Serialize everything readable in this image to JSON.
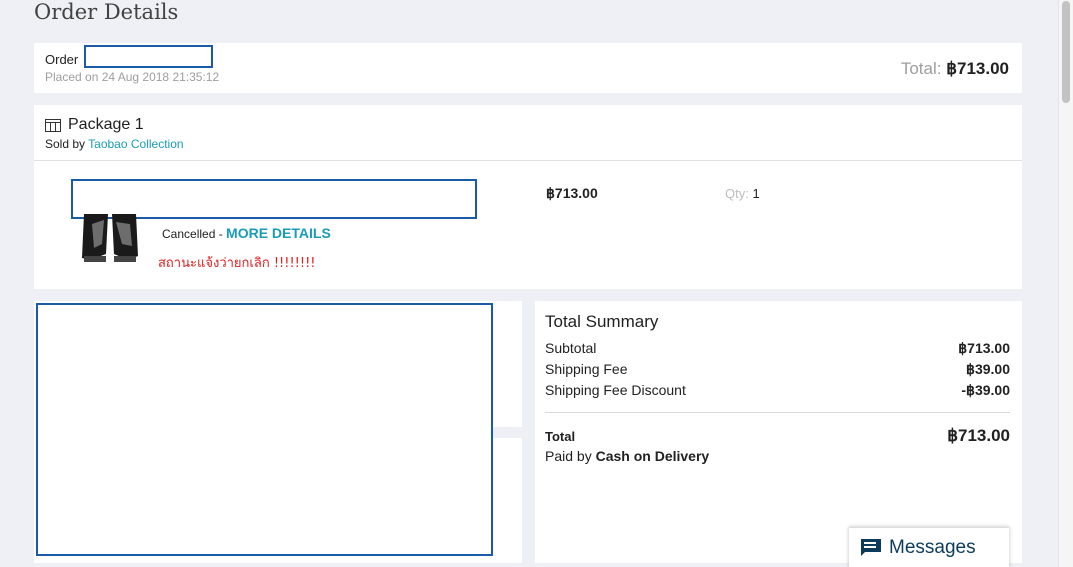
{
  "page": {
    "title": "Order Details"
  },
  "order": {
    "label": "Order",
    "placed": "Placed on 24 Aug 2018 21:35:12",
    "total_label": "Total:",
    "total_value": "฿713.00"
  },
  "package": {
    "title": "Package 1",
    "sold_by_label": "Sold by",
    "seller": "Taobao Collection",
    "item": {
      "price": "฿713.00",
      "qty_label": "Qty:",
      "qty_value": "1",
      "status": "Cancelled",
      "status_sep": " - ",
      "more_details": "MORE DETAILS",
      "note": "สถานะแจ้งว่ายกเลิก !!!!!!!!"
    }
  },
  "summary": {
    "title": "Total Summary",
    "rows": [
      {
        "label": "Subtotal",
        "value": "฿713.00"
      },
      {
        "label": "Shipping Fee",
        "value": "฿39.00"
      },
      {
        "label": "Shipping Fee Discount",
        "value": "-฿39.00"
      }
    ],
    "total_label": "Total",
    "total_value": "฿713.00",
    "paid_by_label": "Paid by",
    "paid_by_method": "Cash on Delivery"
  },
  "messages": {
    "label": "Messages",
    "icon": "chat-icon"
  },
  "icons": {
    "package": "package-icon"
  },
  "colors": {
    "accent": "#1a9cb7",
    "note": "#e02020",
    "redaction_border": "#1b5aa6"
  }
}
